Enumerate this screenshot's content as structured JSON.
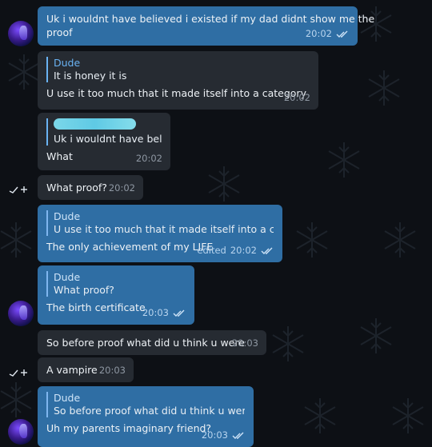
{
  "messages": [
    {
      "text": "Uk i wouldnt have believed i existed if my dad didnt show me the",
      "text2": "proof",
      "time": "20:02"
    },
    {
      "reply_name": "Dude",
      "reply_text": "It is honey it is",
      "text": "U use it too much that it made itself into a category",
      "time": "20:02"
    },
    {
      "reply_text": "Uk i wouldnt have beli...",
      "text": "What",
      "time": "20:02"
    },
    {
      "text": "What proof?",
      "time": "20:02"
    },
    {
      "reply_name": "Dude",
      "reply_text": "U use it too much that it made itself into a cate...",
      "text": "The only achievement of my LIFE",
      "edited": "edited",
      "time": "20:02"
    },
    {
      "reply_name": "Dude",
      "reply_text": "What proof?",
      "text": "The birth certificate",
      "time": "20:03"
    },
    {
      "text": "So before proof what did u think u were",
      "time": "20:03"
    },
    {
      "text": "A vampire",
      "time": "20:03"
    },
    {
      "reply_name": "Dude",
      "reply_text": "So before proof what did u think u were",
      "text": "Uh my parents imaginary friend?",
      "time": "20:03"
    }
  ],
  "colors": {
    "outgoing_bubble": "#2f6ea4",
    "incoming_bubble": "#262b32",
    "background": "#0d1015",
    "reply_accent": "#6ab3f3"
  },
  "icons": [
    "double-check-icon",
    "avatar",
    "sticker-icon"
  ]
}
